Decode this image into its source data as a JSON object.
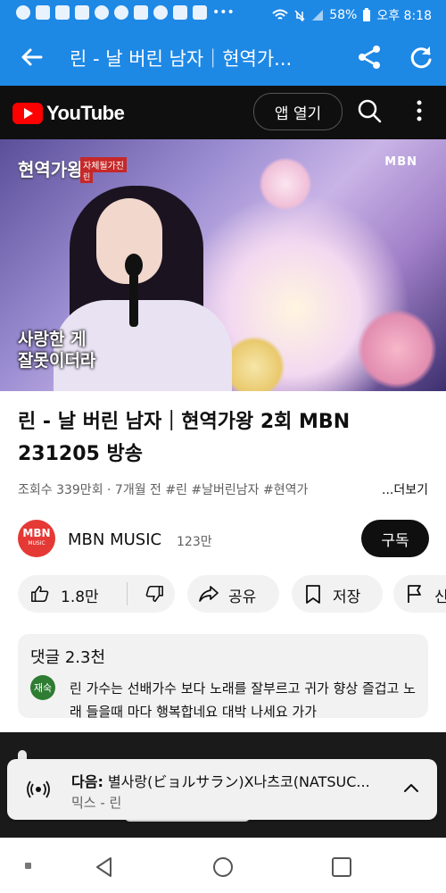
{
  "status_bar": {
    "battery": "58%",
    "time": "오후 8:18"
  },
  "app_bar": {
    "title": "린 - 날 버린 남자｜현역가..."
  },
  "youtube_header": {
    "logo_text": "YouTube",
    "open_app_label": "앱 열기"
  },
  "video": {
    "program_logo": "현역가왕",
    "tag_line1": "자체될가진",
    "tag_line2": "린",
    "broadcaster": "MBN",
    "caption_line1": "사랑한 게",
    "caption_line2": "잘못이더라"
  },
  "title": "린 - 날 버린 남자｜현역가왕 2회 MBN 231205 방송",
  "meta": {
    "views_line": "조회수 339만회 · 7개월 전 #린 #날버린남자 #현역가",
    "more_label": "...더보기"
  },
  "channel": {
    "avatar_text": "MBN",
    "avatar_sub": "MUSIC",
    "name": "MBN MUSIC",
    "subscribers": "123만",
    "subscribe_label": "구독"
  },
  "actions": {
    "like_count": "1.8만",
    "share_label": "공유",
    "save_label": "저장",
    "report_label": "신"
  },
  "comments": {
    "header": "댓글 2.3천",
    "avatar_text": "재숙",
    "text": "린 가수는 선배가수 보다 노래를 잘부르고 귀가 향상 즐겁고 노래 들을때 마다 행복합네요 대박 나세요 가가"
  },
  "mini_player": {
    "next_prefix": "다음:",
    "next_title": "별사랑(ビョルサラン)X나츠코(NATSUC...",
    "subtitle": "믹스 - 린"
  },
  "colors": {
    "app_blue": "#1e88e5",
    "youtube_red": "#ff0000",
    "dark_bg": "#0f0f0f"
  }
}
